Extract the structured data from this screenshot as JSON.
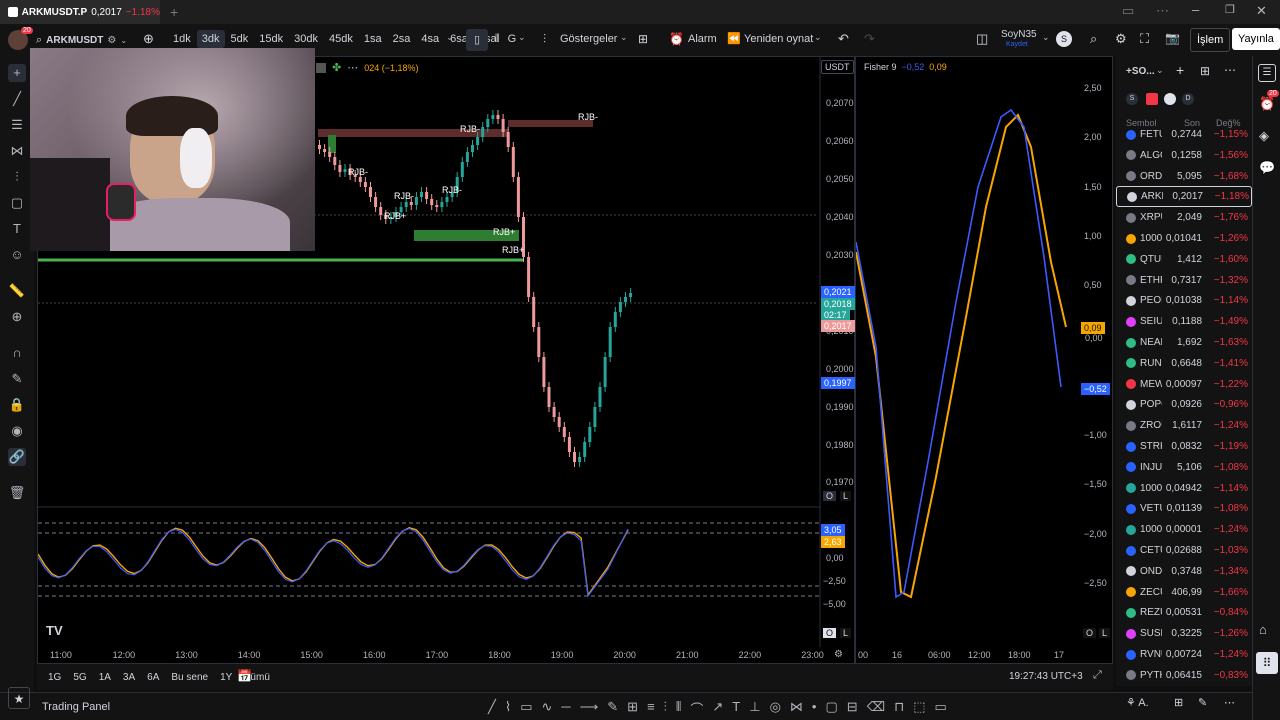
{
  "window": {
    "tab_title": "ARKMUSDT.P",
    "tab_price": "0,2017",
    "tab_change": "−1.18%",
    "new_tab_icon": "plus-icon"
  },
  "toolbar": {
    "avatar_badge": "20",
    "symbol": "ARKMUSDT",
    "intervals": [
      "1dk",
      "3dk",
      "5dk",
      "15dk",
      "30dk",
      "45dk",
      "1sa",
      "2sa",
      "4sa",
      "6sa",
      "8sa",
      "G"
    ],
    "active_interval": "3dk",
    "indicators_label": "Göstergeler",
    "alarm_label": "Alarm",
    "replay_label": "Yeniden oynat",
    "layout_name": "SoyN35",
    "layout_sub": "Kaydet",
    "trade_label": "İşlem",
    "publish_label": "Yayınla"
  },
  "chart": {
    "legend_value": "024 (−1,18%)",
    "currency_btn": "USDT",
    "price_ticks": [
      "0,2070",
      "0,2060",
      "0,2050",
      "0,2040",
      "0,2030",
      "0,2010",
      "0,2000",
      "0,1990",
      "0,1980",
      "0,1970"
    ],
    "tag_blue_top": "0,2021",
    "tag_green": "0,2018",
    "tag_countdown": "02:17",
    "tag_red": "0,2017",
    "tag_blue_bottom": "0,1997",
    "rjb_labels": [
      "RJB-",
      "RJB-",
      "RJB-",
      "RJB-",
      "RJB-",
      "RJB+",
      "RJB+",
      "RJB+"
    ],
    "osc_ticks": [
      "0,00",
      "−2,50",
      "−5,00"
    ],
    "osc_tag_blue": "3,05",
    "osc_tag_orange": "2,63",
    "time_ticks": [
      "11:00",
      "12:00",
      "13:00",
      "14:00",
      "15:00",
      "16:00",
      "17:00",
      "18:00",
      "19:00",
      "20:00",
      "21:00",
      "22:00",
      "23:00"
    ],
    "btn_o": "O",
    "btn_l": "L",
    "logo": "TV"
  },
  "fisher": {
    "legend_name": "Fisher 9",
    "legend_v1": "−0,52",
    "legend_v2": "0,09",
    "ticks": [
      "2,50",
      "2,00",
      "1,50",
      "1,00",
      "0,50",
      "−1,00",
      "−1,50",
      "−2,00",
      "−2,50"
    ],
    "tag_orange": "0,09",
    "tag_blue": "−0,52",
    "zero_tick": "0,00",
    "time_ticks": [
      "00",
      "16",
      "06:00",
      "12:00",
      "18:00",
      "17"
    ],
    "btn_o": "O",
    "btn_l": "L"
  },
  "bottombar": {
    "ranges": [
      "1G",
      "5G",
      "1A",
      "3A",
      "6A",
      "Bu sene",
      "1Y",
      "Tümü"
    ],
    "clock": "19:27:43 UTC+3"
  },
  "footer": {
    "trading_panel": "Trading Panel"
  },
  "watchlist": {
    "title": "+SO...",
    "col_symbol": "Sembol",
    "col_last": "Son",
    "col_change": "Değ%",
    "rows": [
      {
        "sym": "FETU",
        "last": "0,2744",
        "chg": "−1,15%",
        "color": "#2962ff"
      },
      {
        "sym": "ALGO",
        "last": "0,1258",
        "chg": "−1,56%",
        "color": "#787b86"
      },
      {
        "sym": "ORDI",
        "last": "5,095",
        "chg": "−1,68%",
        "color": "#787b86"
      },
      {
        "sym": "ARKM",
        "last": "0,2017",
        "chg": "−1,18%",
        "color": "#d1d4dc"
      },
      {
        "sym": "XRPU",
        "last": "2,049",
        "chg": "−1,76%",
        "color": "#787b86"
      },
      {
        "sym": "1000",
        "last": "0,01041",
        "chg": "−1,26%",
        "color": "#f7a600"
      },
      {
        "sym": "QTUM",
        "last": "1,412",
        "chg": "−1,60%",
        "color": "#2ebd85"
      },
      {
        "sym": "ETHF",
        "last": "0,7317",
        "chg": "−1,32%",
        "color": "#787b86"
      },
      {
        "sym": "PEOP",
        "last": "0,01038",
        "chg": "−1,14%",
        "color": "#d1d4dc"
      },
      {
        "sym": "SEIU",
        "last": "0,1188",
        "chg": "−1,49%",
        "color": "#e040fb"
      },
      {
        "sym": "NEAR",
        "last": "1,692",
        "chg": "−1,63%",
        "color": "#2ebd85"
      },
      {
        "sym": "RUNE",
        "last": "0,6648",
        "chg": "−1,41%",
        "color": "#2ebd85"
      },
      {
        "sym": "MEW",
        "last": "0,00097",
        "chg": "−1,22%",
        "color": "#f23645"
      },
      {
        "sym": "POPC",
        "last": "0,0926",
        "chg": "−0,96%",
        "color": "#d1d4dc"
      },
      {
        "sym": "ZROU",
        "last": "1,6117",
        "chg": "−1,24%",
        "color": "#787b86"
      },
      {
        "sym": "STRK",
        "last": "0,0832",
        "chg": "−1,19%",
        "color": "#2962ff"
      },
      {
        "sym": "INJU",
        "last": "5,106",
        "chg": "−1,08%",
        "color": "#2962ff"
      },
      {
        "sym": "1000",
        "last": "0,04942",
        "chg": "−1,14%",
        "color": "#26a69a"
      },
      {
        "sym": "VETU",
        "last": "0,01139",
        "chg": "−1,08%",
        "color": "#2962ff"
      },
      {
        "sym": "1000",
        "last": "0,00001",
        "chg": "−1,24%",
        "color": "#26a69a"
      },
      {
        "sym": "CETU",
        "last": "0,02688",
        "chg": "−1,03%",
        "color": "#2962ff"
      },
      {
        "sym": "ONDO",
        "last": "0,3748",
        "chg": "−1,34%",
        "color": "#d1d4dc"
      },
      {
        "sym": "ZECU",
        "last": "406,99",
        "chg": "−1,66%",
        "color": "#f7a600"
      },
      {
        "sym": "REZU",
        "last": "0,00531",
        "chg": "−0,84%",
        "color": "#2ebd85"
      },
      {
        "sym": "SUSH",
        "last": "0,3225",
        "chg": "−1,26%",
        "color": "#e040fb"
      },
      {
        "sym": "RVNU",
        "last": "0,00724",
        "chg": "−1,24%",
        "color": "#2962ff"
      },
      {
        "sym": "PYTH",
        "last": "0,06415",
        "chg": "−0,83%",
        "color": "#787b86"
      }
    ]
  },
  "rightbar": {
    "badge": "20"
  },
  "colors": {
    "fisher_orange": "#f7a600",
    "fisher_blue": "#3d5afe",
    "up": "#26a69a",
    "down": "#ef9a9a"
  }
}
